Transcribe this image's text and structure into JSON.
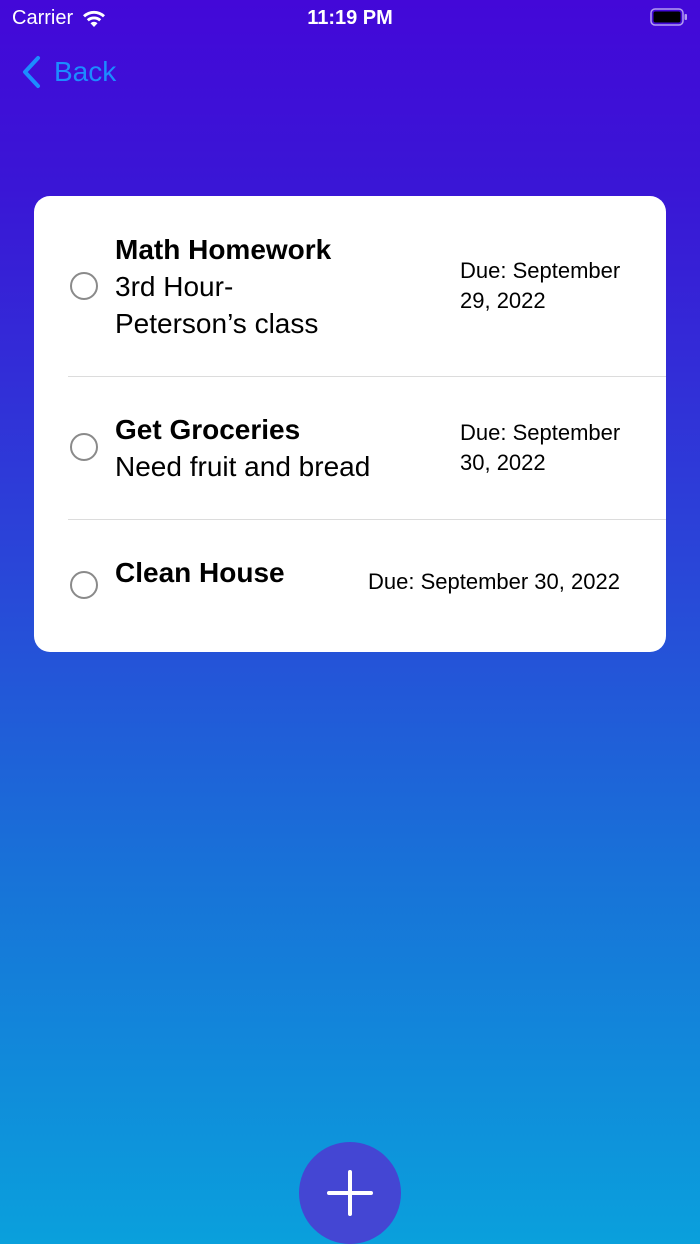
{
  "status_bar": {
    "carrier": "Carrier",
    "time": "11:19 PM"
  },
  "nav": {
    "back_label": "Back"
  },
  "tasks": [
    {
      "title": "Math Homework",
      "description_lines": [
        "3rd Hour-",
        "Peterson’s class"
      ],
      "due_lines": [
        "Due: September",
        "29, 2022"
      ]
    },
    {
      "title": "Get Groceries",
      "description_lines": [
        "Need fruit and bread"
      ],
      "due_lines": [
        "Due: September",
        "30, 2022"
      ]
    },
    {
      "title": "Clean House",
      "description_lines": [],
      "due_lines": [
        "Due: September 30, 2022"
      ]
    }
  ],
  "colors": {
    "accent": "#1c8cff",
    "fab": "#4446d3",
    "gradient_top": "#4308d8",
    "gradient_bottom": "#0aa0dc"
  },
  "icons": {
    "wifi": "wifi-icon",
    "battery": "battery-icon",
    "back": "chevron-left-icon",
    "add": "plus-icon",
    "checkbox": "circle-checkbox-icon"
  }
}
